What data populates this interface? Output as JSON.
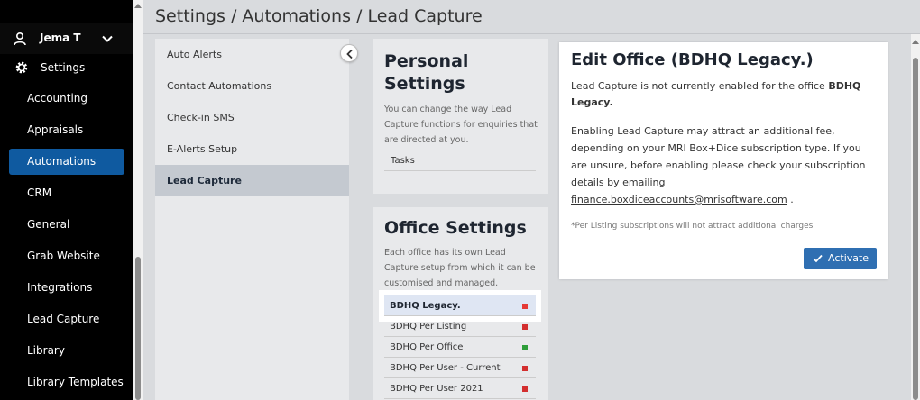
{
  "user": {
    "name": "Jema T"
  },
  "sidebar": {
    "settings_label": "Settings",
    "items": [
      {
        "label": "Accounting",
        "active": false
      },
      {
        "label": "Appraisals",
        "active": false
      },
      {
        "label": "Automations",
        "active": true
      },
      {
        "label": "CRM",
        "active": false
      },
      {
        "label": "General",
        "active": false
      },
      {
        "label": "Grab Website",
        "active": false
      },
      {
        "label": "Integrations",
        "active": false
      },
      {
        "label": "Lead Capture",
        "active": false
      },
      {
        "label": "Library",
        "active": false
      },
      {
        "label": "Library Templates",
        "active": false
      }
    ]
  },
  "header": {
    "breadcrumb": "Settings / Automations / Lead Capture"
  },
  "submenu": {
    "items": [
      {
        "label": "Auto Alerts",
        "active": false
      },
      {
        "label": "Contact Automations",
        "active": false
      },
      {
        "label": "Check-in SMS",
        "active": false
      },
      {
        "label": "E-Alerts Setup",
        "active": false
      },
      {
        "label": "Lead Capture",
        "active": true
      }
    ]
  },
  "personal": {
    "title_line1": "Personal",
    "title_line2": "Settings",
    "desc_line1": "You can change the way Lead",
    "desc_line2": "Capture functions for enquiries that",
    "desc_line3": "are directed at you.",
    "tasks_label": "Tasks"
  },
  "office": {
    "title": "Office Settings",
    "desc_line1": "Each office has its own Lead",
    "desc_line2": "Capture setup from which it can be",
    "desc_line3": "customised and managed.",
    "items": [
      {
        "label": "BDHQ Legacy.",
        "status_color": "#e53935",
        "selected": true
      },
      {
        "label": "BDHQ Per Listing",
        "status_color": "#d32f2f",
        "selected": false
      },
      {
        "label": "BDHQ Per Office",
        "status_color": "#2e9e3a",
        "selected": false
      },
      {
        "label": "BDHQ Per User - Current",
        "status_color": "#d32f2f",
        "selected": false
      },
      {
        "label": "BDHQ Per User 2021",
        "status_color": "#d32f2f",
        "selected": false
      }
    ]
  },
  "edit": {
    "title": "Edit Office (BDHQ Legacy.)",
    "p1_text": "Lead Capture is not currently enabled for the office",
    "p1_bold": "BDHQ Legacy.",
    "p2_line1": "Enabling Lead Capture may attract an additional fee,",
    "p2_line2": "depending on your MRI Box+Dice subscription type. If you",
    "p2_line3": "are unsure, before enabling please check your subscription",
    "p2_line4": "details by emailing",
    "email": "finance.boxdiceaccounts@mrisoftware.com",
    "email_suffix": " .",
    "note": "*Per Listing subscriptions will not attract additional charges",
    "activate_label": "Activate"
  },
  "colors": {
    "accent": "#2f6fb2",
    "nav_active": "#0f5aa0"
  }
}
